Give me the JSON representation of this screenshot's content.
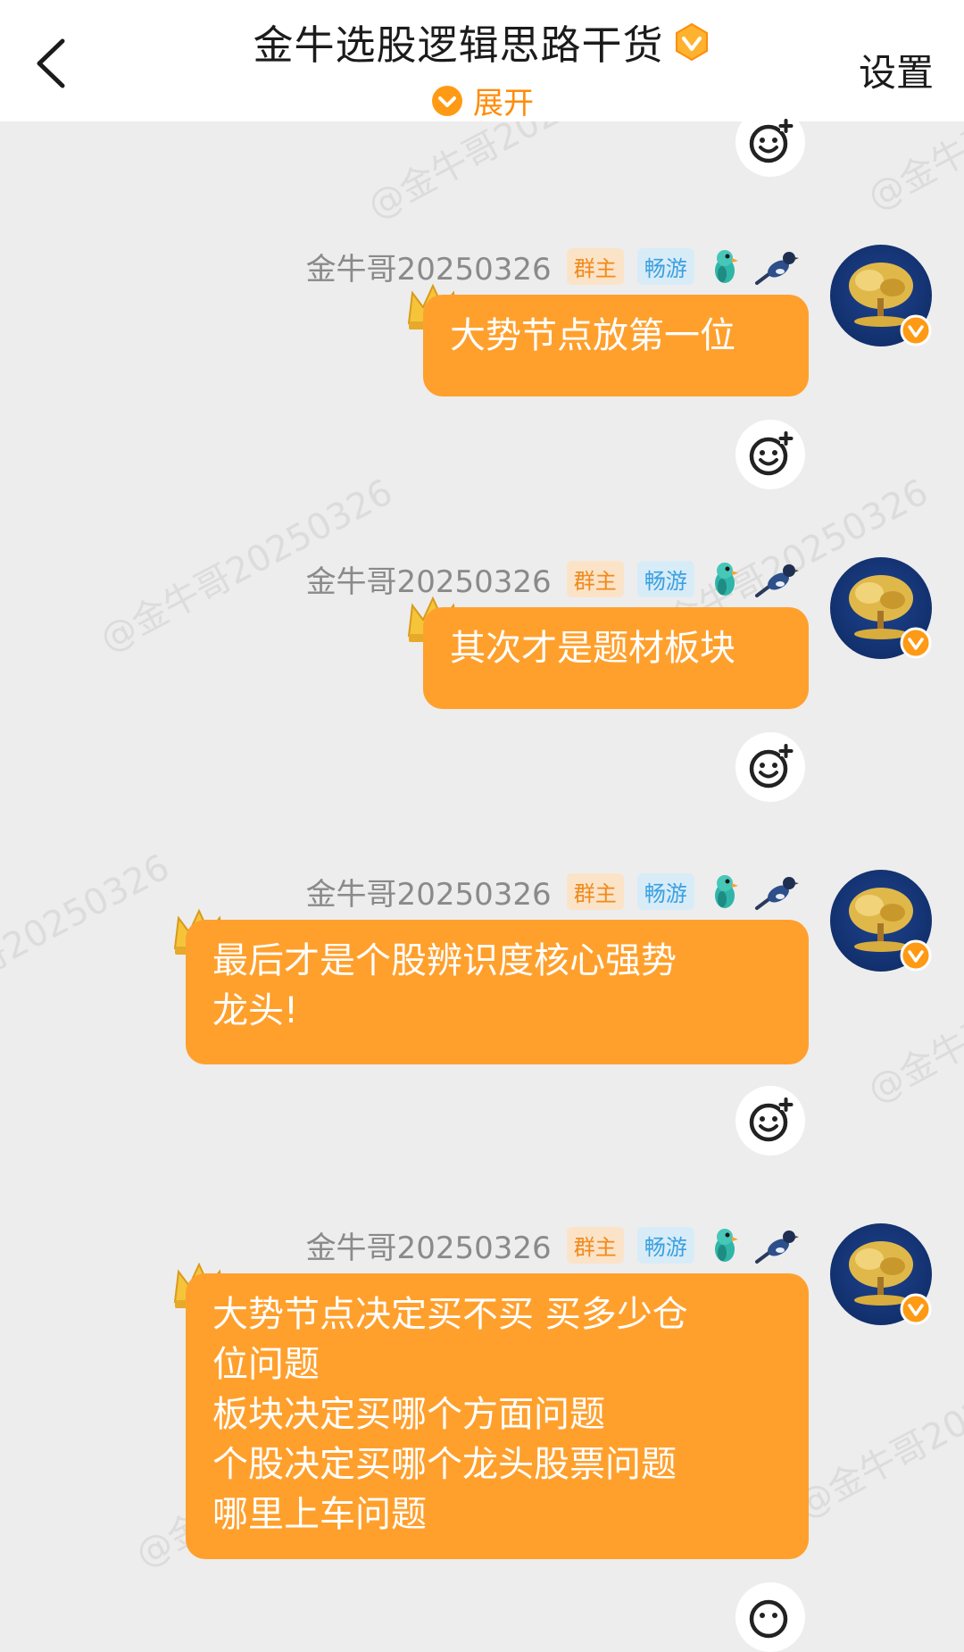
{
  "header": {
    "title": "金牛选股逻辑思路干货",
    "expand_label": "展开",
    "settings_label": "设置"
  },
  "watermark_text": "@金牛哥20250326",
  "messages": [
    {
      "sender": "金牛哥20250326",
      "role_tag": "群主",
      "level_tag": "畅游",
      "lines": [
        "大势节点放第一位"
      ]
    },
    {
      "sender": "金牛哥20250326",
      "role_tag": "群主",
      "level_tag": "畅游",
      "lines": [
        "其次才是题材板块"
      ]
    },
    {
      "sender": "金牛哥20250326",
      "role_tag": "群主",
      "level_tag": "畅游",
      "lines": [
        "最后才是个股辨识度核心强势",
        "龙头!"
      ]
    },
    {
      "sender": "金牛哥20250326",
      "role_tag": "群主",
      "level_tag": "畅游",
      "lines": [
        "大势节点决定买不买 买多少仓",
        "位问题",
        "板块决定买哪个方面问题",
        "个股决定买哪个龙头股票问题",
        "哪里上车问题"
      ]
    }
  ],
  "colors": {
    "accent": "#ffa02d",
    "expand": "#ff8c0a",
    "background": "#ededed"
  }
}
